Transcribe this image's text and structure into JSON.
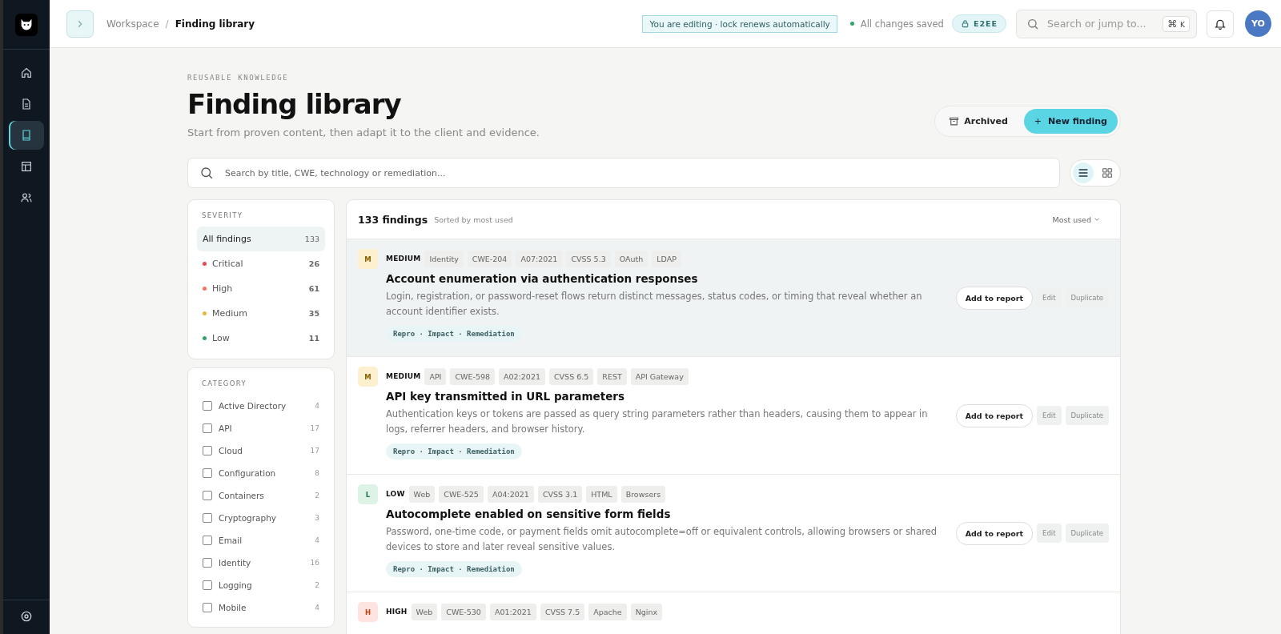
{
  "nav": [
    {
      "kind": "home",
      "selected": false
    },
    {
      "kind": "document",
      "selected": false
    },
    {
      "kind": "book",
      "selected": true
    },
    {
      "kind": "layout",
      "selected": false
    },
    {
      "kind": "users",
      "selected": false
    }
  ],
  "header": {
    "breadcrumb": [
      "Workspace",
      "Finding library"
    ],
    "separator": "/",
    "editing_notice": "You are editing · lock renews automatically",
    "save_status": "All changes saved",
    "encryption_badge": "E2EE",
    "search": {
      "placeholder": "Search or jump to...",
      "shortcut": [
        "⌘",
        "K"
      ]
    },
    "avatar": "YO"
  },
  "page": {
    "eyebrow": "REUSABLE KNOWLEDGE",
    "title": "Finding library",
    "subtitle": "Start from proven content, then adapt it to the client and evidence.",
    "archived_button": "Archived",
    "new_button_icon": "+",
    "new_button": "New finding",
    "search": {
      "placeholder": "Search by title, CWE, technology or remediation..."
    },
    "view_modes": [
      {
        "kind": "list",
        "selected": true
      },
      {
        "kind": "grid",
        "selected": false
      }
    ]
  },
  "severity_filter": {
    "heading": "SEVERITY",
    "items": [
      {
        "label": "All findings",
        "count": "133",
        "selected": true
      },
      {
        "label": "Critical",
        "count": "26",
        "selected": false,
        "color": "#e5484d"
      },
      {
        "label": "High",
        "count": "61",
        "selected": false,
        "color": "#f7735e"
      },
      {
        "label": "Medium",
        "count": "35",
        "selected": false,
        "color": "#e8b53c"
      },
      {
        "label": "Low",
        "count": "11",
        "selected": false,
        "color": "#30a46c"
      }
    ]
  },
  "category_filter": {
    "heading": "CATEGORY",
    "items": [
      {
        "label": "Active Directory",
        "count": "4",
        "checked": false
      },
      {
        "label": "API",
        "count": "17",
        "checked": false
      },
      {
        "label": "Cloud",
        "count": "17",
        "checked": false
      },
      {
        "label": "Configuration",
        "count": "8",
        "checked": false
      },
      {
        "label": "Containers",
        "count": "2",
        "checked": false
      },
      {
        "label": "Cryptography",
        "count": "3",
        "checked": false
      },
      {
        "label": "Email",
        "count": "4",
        "checked": false
      },
      {
        "label": "Identity",
        "count": "16",
        "checked": false
      },
      {
        "label": "Logging",
        "count": "2",
        "checked": false
      },
      {
        "label": "Mobile",
        "count": "4",
        "checked": false
      }
    ]
  },
  "results": {
    "count": "133 findings",
    "sort_note": "Sorted by most used",
    "sort_menu": "Most used",
    "findings": [
      {
        "kind": "medium",
        "letter": "M",
        "severity_label": "MEDIUM",
        "tags": [
          "Identity",
          "CWE-204",
          "A07:2021",
          "CVSS 5.3",
          "OAuth",
          "LDAP"
        ],
        "title": "Account enumeration via authentication responses",
        "description": "Login, registration, or password-reset flows return distinct messages, status codes, or timing that reveal whether an account identifier exists.",
        "sections": "Repro · Impact · Remediation",
        "selected": true,
        "actions": [
          "Add to report",
          "Edit",
          "Duplicate"
        ]
      },
      {
        "kind": "medium",
        "letter": "M",
        "severity_label": "MEDIUM",
        "tags": [
          "API",
          "CWE-598",
          "A02:2021",
          "CVSS 6.5",
          "REST",
          "API Gateway"
        ],
        "title": "API key transmitted in URL parameters",
        "description": "Authentication keys or tokens are passed as query string parameters rather than headers, causing them to appear in logs, referrer headers, and browser history.",
        "sections": "Repro · Impact · Remediation",
        "selected": false,
        "actions": [
          "Add to report",
          "Edit",
          "Duplicate"
        ]
      },
      {
        "kind": "low",
        "letter": "L",
        "severity_label": "LOW",
        "tags": [
          "Web",
          "CWE-525",
          "A04:2021",
          "CVSS 3.1",
          "HTML",
          "Browsers"
        ],
        "title": "Autocomplete enabled on sensitive form fields",
        "description": "Password, one-time code, or payment fields omit autocomplete=off or equivalent controls, allowing browsers or shared devices to store and later reveal sensitive values.",
        "sections": "Repro · Impact · Remediation",
        "selected": false,
        "actions": [
          "Add to report",
          "Edit",
          "Duplicate"
        ]
      },
      {
        "kind": "high",
        "letter": "H",
        "severity_label": "HIGH",
        "tags": [
          "Web",
          "CWE-530",
          "A01:2021",
          "CVSS 7.5",
          "Apache",
          "Nginx"
        ],
        "selected": false
      }
    ]
  }
}
